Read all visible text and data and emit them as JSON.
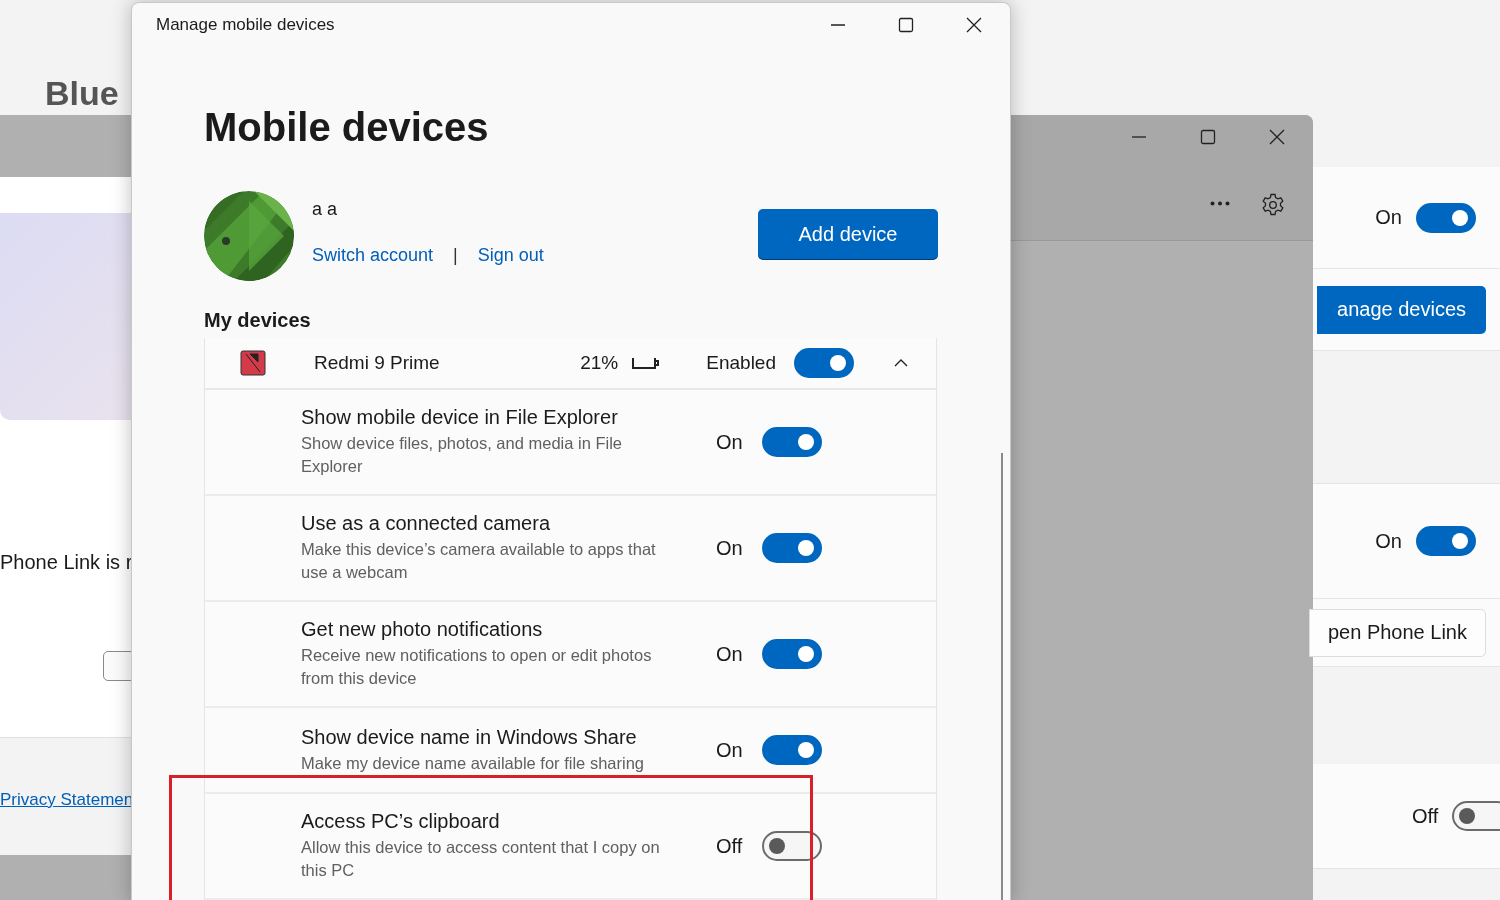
{
  "background_window": {
    "heading": "Blue",
    "status_text": "Phone Link is r",
    "link": "Privacy Statemen",
    "checked": false
  },
  "settings_panel": {
    "rows": [
      {
        "kind": "toggle",
        "label": "On",
        "on": true
      },
      {
        "kind": "button",
        "label": "anage devices",
        "primary": true
      },
      {
        "kind": "empty"
      },
      {
        "kind": "toggle",
        "label": "On",
        "on": true
      },
      {
        "kind": "button",
        "label": "pen Phone Link",
        "primary": false
      },
      {
        "kind": "toggle",
        "label": "Off",
        "on": false
      }
    ]
  },
  "dialog": {
    "title": "Manage mobile devices",
    "heading": "Mobile devices",
    "account": {
      "name": "a a",
      "links": [
        "Switch account",
        "Sign out"
      ],
      "separator": "|"
    },
    "add_button": "Add device",
    "section_title": "My devices",
    "device": {
      "name": "Redmi 9 Prime",
      "battery": "21%",
      "status": "Enabled",
      "on": true,
      "expanded": true
    },
    "settings": [
      {
        "title": "Show mobile device in File Explorer",
        "description": "Show device files, photos, and media in File Explorer",
        "state": "On",
        "on": true,
        "highlighted": false
      },
      {
        "title": "Use as a connected camera",
        "description": "Make this device’s camera available to apps that use a webcam",
        "state": "On",
        "on": true,
        "highlighted": false
      },
      {
        "title": "Get new photo notifications",
        "description": "Receive new notifications to open or edit photos from this device",
        "state": "On",
        "on": true,
        "highlighted": false
      },
      {
        "title": "Show device name in Windows Share",
        "description": "Make my device name available for file sharing",
        "state": "On",
        "on": true,
        "highlighted": false
      },
      {
        "title": "Access PC’s clipboard",
        "description": "Allow this device to access content that I copy on this PC",
        "state": "Off",
        "on": false,
        "highlighted": true
      }
    ]
  }
}
